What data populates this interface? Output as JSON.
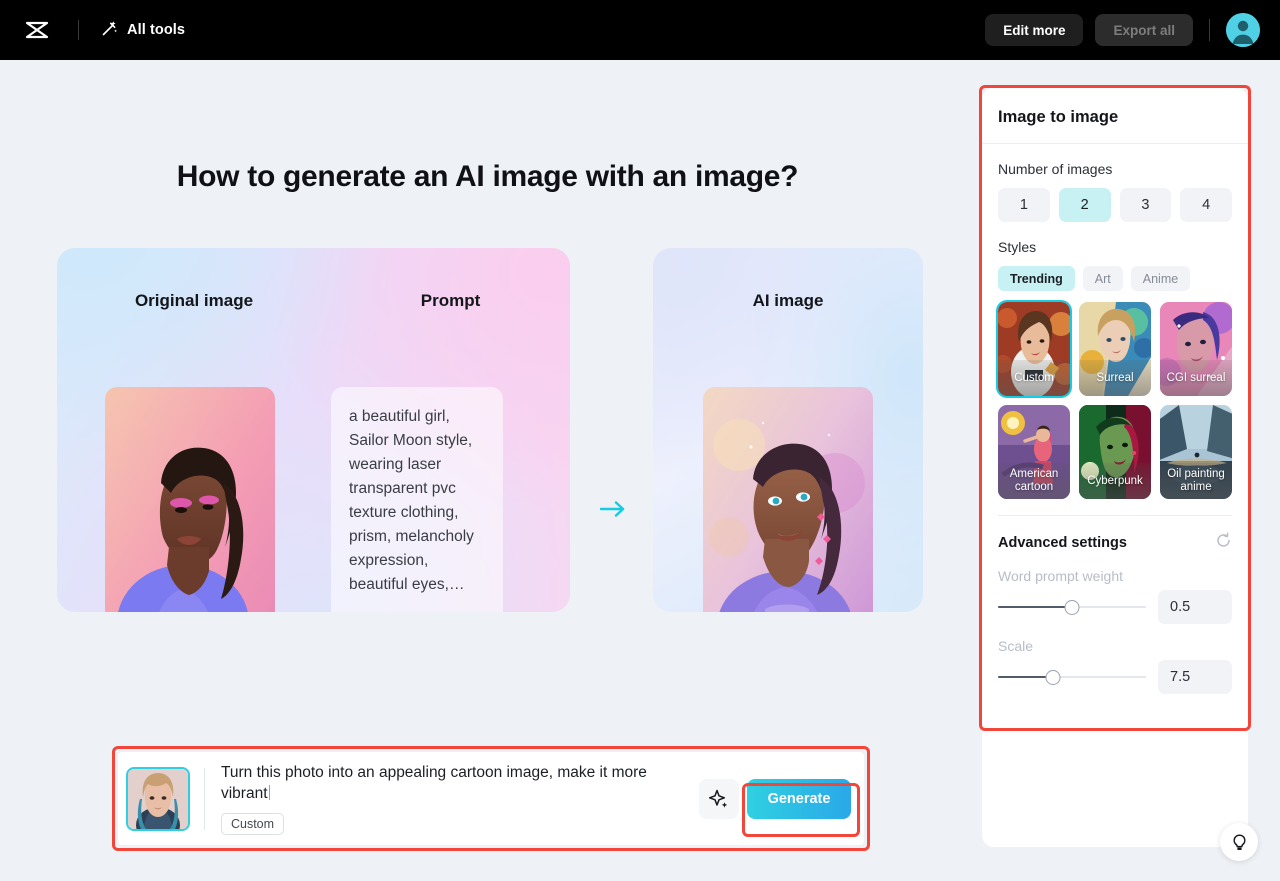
{
  "topbar": {
    "logo_icon": "capcut-logo-icon",
    "all_tools_label": "All tools",
    "all_tools_icon": "magic-wand-icon",
    "edit_more_label": "Edit more",
    "export_all_label": "Export all",
    "avatar_icon": "user-avatar-icon"
  },
  "main": {
    "headline": "How to generate an AI image with an image?",
    "left_card": {
      "original_title": "Original image",
      "prompt_title": "Prompt",
      "prompt_text": "a beautiful girl, Sailor Moon style, wearing laser transparent pvc texture clothing, prism, melancholy expression, beautiful eyes,…"
    },
    "right_card": {
      "title": "AI image"
    },
    "plus_icon": "plus-icon",
    "arrow_icon": "arrow-right-icon"
  },
  "prompt_bar": {
    "thumbnail_icon": "uploaded-photo-thumbnail",
    "text": "Turn this photo into an appealing cartoon image, make it more vibrant",
    "style_tag": "Custom",
    "sparkle_icon": "magic-sparkle-icon",
    "generate_label": "Generate"
  },
  "panel": {
    "title": "Image to image",
    "number_of_images_label": "Number of images",
    "number_options": [
      "1",
      "2",
      "3",
      "4"
    ],
    "number_selected": "2",
    "styles_label": "Styles",
    "style_tabs": [
      "Trending",
      "Art",
      "Anime"
    ],
    "style_tab_selected": "Trending",
    "styles": [
      {
        "label": "Custom",
        "selected": true
      },
      {
        "label": "Surreal",
        "selected": false
      },
      {
        "label": "CGI surreal",
        "selected": false
      },
      {
        "label": "American cartoon",
        "selected": false
      },
      {
        "label": "Cyberpunk",
        "selected": false
      },
      {
        "label": "Oil painting anime",
        "selected": false
      }
    ],
    "advanced_title": "Advanced settings",
    "reset_icon": "reset-icon",
    "sliders": [
      {
        "label": "Word prompt weight",
        "value": "0.5",
        "percent": 50
      },
      {
        "label": "Scale",
        "value": "7.5",
        "percent": 37
      }
    ]
  },
  "help": {
    "icon": "lightbulb-icon"
  },
  "colors": {
    "accent_cyan": "#14cde4",
    "annotation_red": "#f2463a",
    "chip_active": "#c7f1f3",
    "page_bg": "#eef1f5"
  }
}
